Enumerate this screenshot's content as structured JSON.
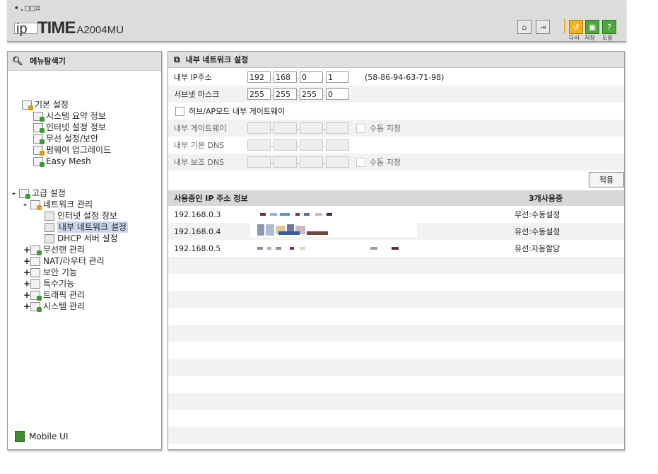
{
  "header": {
    "brand_dots": "•.□□∷",
    "logo_ip": "ip",
    "logo_time": "TIME",
    "logo_model": "A2004MU",
    "buttons": [
      {
        "icon": "home-icon"
      },
      {
        "icon": "logout-icon"
      },
      {
        "icon": "refresh-icon",
        "label": "다시"
      },
      {
        "icon": "save-icon",
        "label": "저장"
      },
      {
        "icon": "help-icon",
        "label": "도움"
      }
    ]
  },
  "sidebar": {
    "title": "메뉴탐색기",
    "basic_label": "기본 설정",
    "basic_items": [
      "시스템 요약 정보",
      "인터넷 설정 정보",
      "무선 설정/보안",
      "펌웨어 업그레이드",
      "Easy Mesh"
    ],
    "advanced_label": "고급 설정",
    "network_label": "네트워크 관리",
    "network_items": [
      "인터넷 설정 정보",
      "내부 네트워크 설정",
      "DHCP 서버 설정"
    ],
    "advanced_items": [
      "무선랜 관리",
      "NAT/라우터 관리",
      "보안 기능",
      "특수기능",
      "트래픽 관리",
      "시스템 관리"
    ],
    "collapsed_marker": "+",
    "expanded_marker": "-",
    "mobile_label": "Mobile UI"
  },
  "panel": {
    "title": "내부 네트워크 설정",
    "ip_label": "내부 IP주소",
    "ip": [
      "192",
      "168",
      "0",
      "1"
    ],
    "mac": "(58-86-94-63-71-98)",
    "mask_label": "서브넷 마스크",
    "mask": [
      "255",
      "255",
      "255",
      "0"
    ],
    "hub_label": "허브/AP모드 내부 게이트웨이",
    "gw_label": "내부 게이트웨이",
    "dns1_label": "내부 기본 DNS",
    "dns2_label": "내부 보조 DNS",
    "manual_label": "수동 지정",
    "apply_label": "적용"
  },
  "iptable": {
    "header": "사용중인 IP 주소 정보",
    "count": "3개사용중",
    "rows": [
      {
        "ip": "192.168.0.3",
        "status": "무선:수동설정"
      },
      {
        "ip": "192.168.0.4",
        "status": "유선:수동설정"
      },
      {
        "ip": "192.168.0.5",
        "status": "유선:자동할당"
      }
    ]
  },
  "colors": {
    "header_bg": "#dcdcdc",
    "panel_head": "#e0e0e0",
    "accent_orange": "#f2b21c",
    "accent_green": "#4ea63c",
    "selected": "#c9d6ee"
  }
}
